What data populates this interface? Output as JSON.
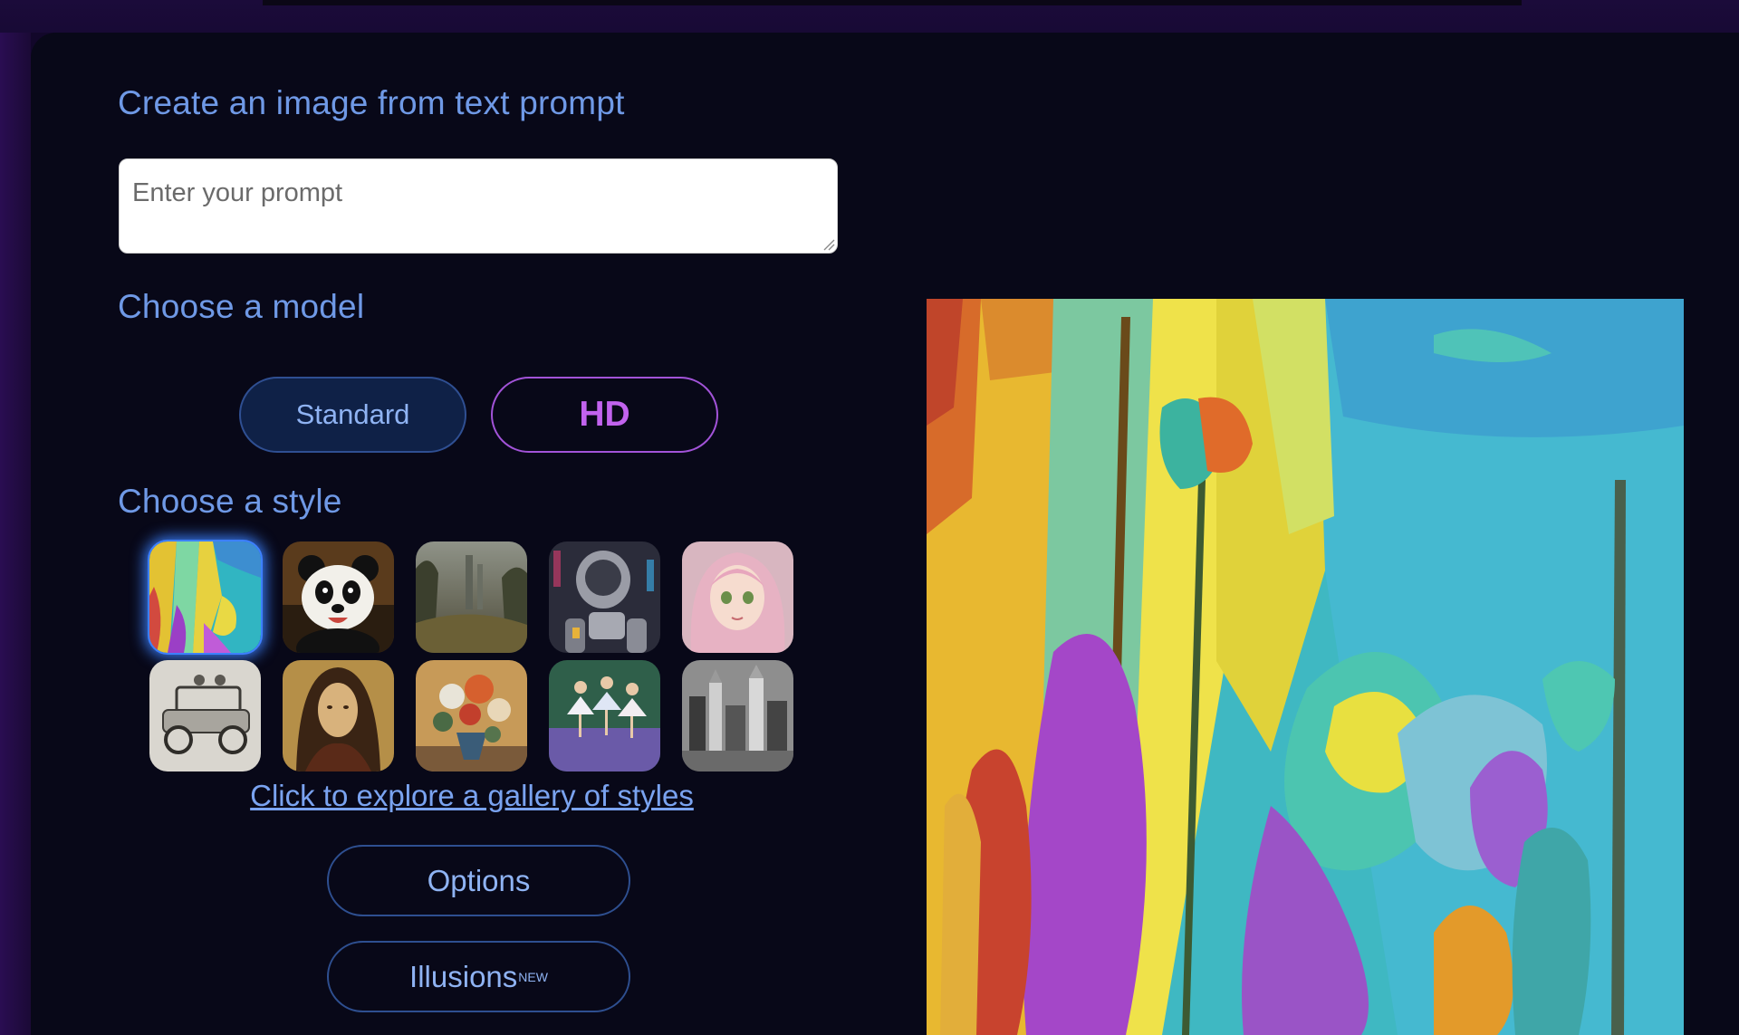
{
  "generator": {
    "prompt_heading": "Create an image from text prompt",
    "prompt_placeholder": "Enter your prompt",
    "prompt_value": "",
    "model_heading": "Choose a model",
    "models": [
      {
        "label": "Standard",
        "selected": true
      },
      {
        "label": "HD",
        "selected": false
      }
    ],
    "style_heading": "Choose a style",
    "styles": [
      {
        "name": "abstract-painting",
        "selected": true
      },
      {
        "name": "panda-cartoon"
      },
      {
        "name": "misty-landscape"
      },
      {
        "name": "cyborg-robot"
      },
      {
        "name": "anime-girl"
      },
      {
        "name": "pencil-sketch-vintage-car"
      },
      {
        "name": "renaissance-portrait"
      },
      {
        "name": "flower-still-life"
      },
      {
        "name": "ballet-dancers"
      },
      {
        "name": "city-sketch"
      }
    ],
    "gallery_link": "Click to explore a gallery of styles",
    "options_label": "Options",
    "illusions_label": "Illusions",
    "illusions_badge": "NEW"
  },
  "preview": {
    "icon": "generated-image-preview"
  },
  "colors": {
    "background": "#080818",
    "heading": "#6f99e6",
    "standard_border": "#2f4f92",
    "hd_accent": "#c263ee",
    "selection_glow": "#3d80ff"
  }
}
